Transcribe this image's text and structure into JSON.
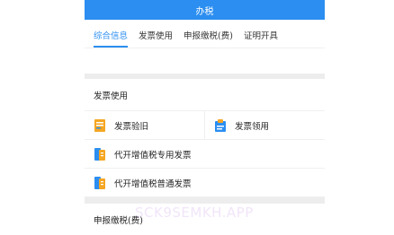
{
  "header": {
    "title": "办税"
  },
  "tabs": [
    {
      "label": "综合信息",
      "active": true
    },
    {
      "label": "发票使用",
      "active": false
    },
    {
      "label": "申报缴税(费)",
      "active": false
    },
    {
      "label": "证明开具",
      "active": false
    }
  ],
  "invoice_section": {
    "title": "发票使用",
    "items": [
      {
        "label": "发票验旧",
        "icon": "invoice-check-icon"
      },
      {
        "label": "发票领用",
        "icon": "invoice-receive-icon"
      },
      {
        "label": "代开增值税专用发票",
        "icon": "vat-special-invoice-icon"
      },
      {
        "label": "代开增值税普通发票",
        "icon": "vat-ordinary-invoice-icon"
      }
    ]
  },
  "declare_section": {
    "title": "申报缴税(费)"
  },
  "watermark": "SCK9SEMKH.APP",
  "colors": {
    "accent": "#2b8ef0",
    "icon_orange": "#f5a623",
    "icon_blue": "#2b8ef0"
  }
}
